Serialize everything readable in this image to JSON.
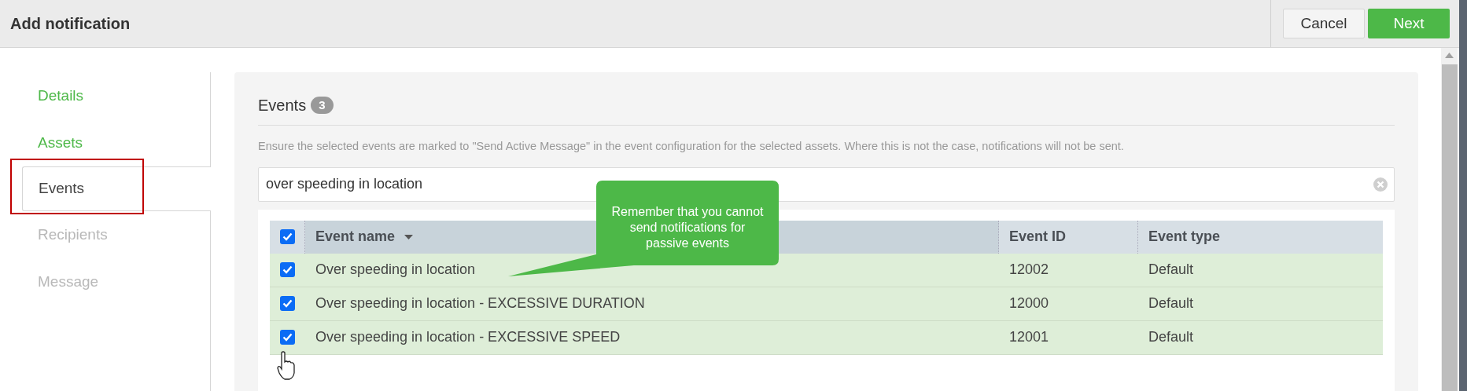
{
  "header": {
    "title": "Add notification",
    "buttons": [
      {
        "label": "Cancel",
        "kind": "secondary"
      },
      {
        "label": "Next",
        "kind": "primary"
      }
    ]
  },
  "steps": [
    {
      "label": "Details",
      "completed": true,
      "selected": false,
      "highlighted": false
    },
    {
      "label": "Assets",
      "completed": true,
      "selected": false,
      "highlighted": false
    },
    {
      "label": "Events",
      "completed": false,
      "selected": true,
      "highlighted": true
    },
    {
      "label": "Recipients",
      "completed": false,
      "selected": false,
      "highlighted": false
    },
    {
      "label": "Message",
      "completed": false,
      "selected": false,
      "highlighted": false
    }
  ],
  "events_panel": {
    "title": "Events",
    "count": "3",
    "note": "Ensure the selected events are marked to \"Send Active Message\" in the event configuration for the selected assets. Where this is not the case, notifications will not be sent.",
    "search": {
      "value": "over speeding in location"
    },
    "table": {
      "select_all_checked": true,
      "columns": [
        {
          "label": "Event name",
          "sorted": true
        },
        {
          "label": "Event ID",
          "sorted": false
        },
        {
          "label": "Event type",
          "sorted": false
        }
      ],
      "rows": [
        {
          "name": "Over speeding in location",
          "event_id": "12002",
          "event_type": "Default",
          "checked": true
        },
        {
          "name": "Over speeding in location - EXCESSIVE DURATION",
          "event_id": "12000",
          "event_type": "Default",
          "checked": true
        },
        {
          "name": "Over speeding in location - EXCESSIVE SPEED",
          "event_id": "12001",
          "event_type": "Default",
          "checked": true
        }
      ]
    }
  },
  "callout": {
    "text": "Remember that you cannot send notifications for passive events"
  }
}
